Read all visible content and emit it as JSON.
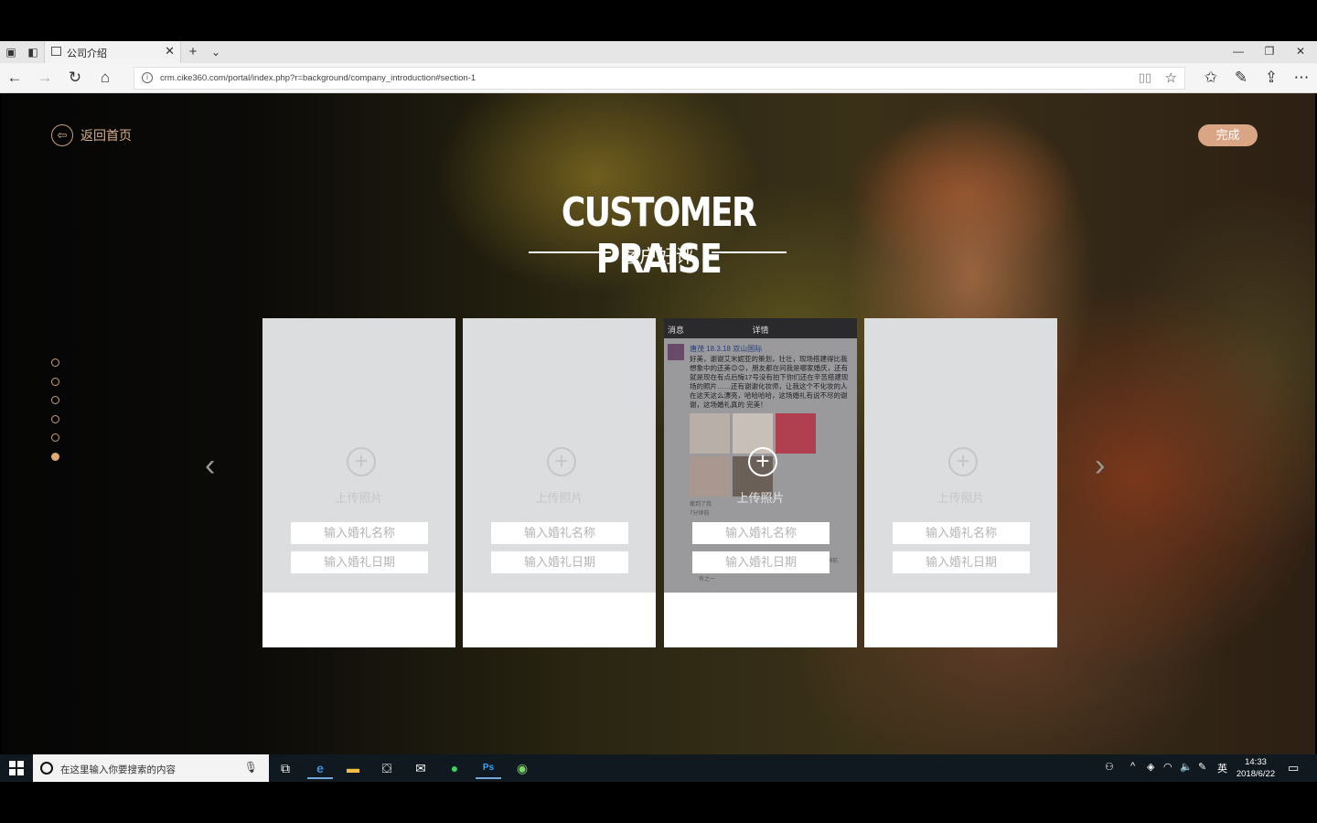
{
  "browser": {
    "tab_title": "公司介绍",
    "url": "crm.cike360.com/portal/index.php?r=background/company_introduction#section-1"
  },
  "page": {
    "back_label": "返回首页",
    "done_label": "完成",
    "heading": "CUSTOMER PRAISE",
    "subheading": "客户好评",
    "nav_dots": [
      false,
      false,
      false,
      false,
      false,
      true
    ],
    "cards": [
      {
        "upload_label": "上传照片",
        "name_placeholder": "输入婚礼名称",
        "date_placeholder": "输入婚礼日期",
        "has_screenshot": false
      },
      {
        "upload_label": "上传照片",
        "name_placeholder": "输入婚礼名称",
        "date_placeholder": "输入婚礼日期",
        "has_screenshot": false
      },
      {
        "upload_label": "上传照片",
        "name_placeholder": "输入婚礼名称",
        "date_placeholder": "输入婚礼日期",
        "has_screenshot": true
      },
      {
        "upload_label": "上传照片",
        "name_placeholder": "输入婚礼名称",
        "date_placeholder": "输入婚礼日期",
        "has_screenshot": false
      }
    ],
    "screenshot": {
      "header_back": "消息",
      "header_title": "详情",
      "username": "唐茂 18.3.18 双山国际",
      "body": "好美，谢谢艾米妮亚的策划，壮壮，现场搭建得比我想象中的还美😊😊，朋友都在问我是哪家婚庆，还有就是现在有点后悔17号没有拍下你们还在辛苦搭建现场的照片……还有谢谢化妆师，让我这个不化妆的人在这天这么漂亮，哈哈哈哈，这场婚礼有说不尽的谢谢，这场婚礼真的 完美！",
      "meta1": "撤到了我",
      "meta2": "7分钟前",
      "meta3": "分钟前",
      "meta4": "有之一"
    }
  },
  "taskbar": {
    "search_placeholder": "在这里输入你要搜索的内容",
    "ime": "英",
    "time": "14:33",
    "date": "2018/6/22"
  },
  "colors": {
    "accent": "#d9a584",
    "card_grey": "#dcddde",
    "taskbar": "#101820"
  }
}
